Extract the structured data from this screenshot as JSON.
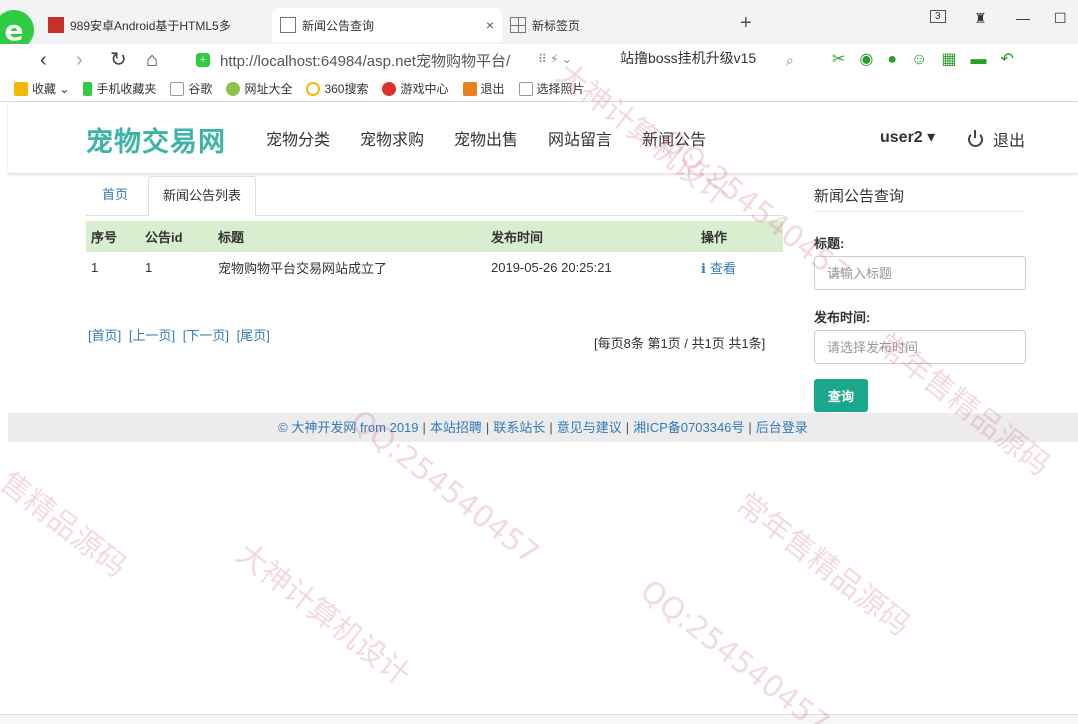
{
  "browser": {
    "tabs": [
      {
        "title": "989安卓Android基于HTML5多"
      },
      {
        "title": "新闻公告查询",
        "close": "×"
      },
      {
        "title": "新标签页"
      }
    ],
    "newtab": "+",
    "tab_count": "3",
    "url": "http://localhost:64984/asp.net宠物购物平台/",
    "search_text": "站撸boss挂机升级v15",
    "bookmarks": [
      "收藏",
      "手机收藏夹",
      "谷歌",
      "网址大全",
      "360搜索",
      "游戏中心",
      "退出",
      "选择照片"
    ]
  },
  "site": {
    "brand": "宠物交易网",
    "nav": [
      "宠物分类",
      "宠物求购",
      "宠物出售",
      "网站留言",
      "新闻公告"
    ],
    "user": "user2 ▾",
    "logout": "退出"
  },
  "breadcrumb": {
    "home": "首页",
    "active": "新闻公告列表"
  },
  "table": {
    "headers": [
      "序号",
      "公告id",
      "标题",
      "发布时间",
      "操作"
    ],
    "rows": [
      {
        "index": "1",
        "id": "1",
        "title": "宠物购物平台交易网站成立了",
        "time": "2019-05-26 20:25:21",
        "op_icon": "i",
        "op": "查看"
      }
    ]
  },
  "pager": {
    "first": "[首页]",
    "prev": "[上一页]",
    "next": "[下一页]",
    "last": "[尾页]",
    "info": "[每页8条 第1页 / 共1页 共1条]"
  },
  "query": {
    "title": "新闻公告查询",
    "title_label": "标题:",
    "title_placeholder": "请输入标题",
    "time_label": "发布时间:",
    "time_placeholder": "请选择发布时间",
    "submit": "查询"
  },
  "footer": {
    "copyright": "© 大神开发网 from 2019",
    "links": [
      "本站招聘",
      "联系站长",
      "意见与建议",
      "湘ICP备0703346号",
      "后台登录"
    ],
    "separator": "|"
  },
  "watermarks": [
    "大神计算机设计",
    "QQ:254540457",
    "常年售精品源码",
    "售精品源码",
    "QQ:254540457",
    "大神计算机设计",
    "常年售精品源码",
    "QQ:254540457"
  ]
}
